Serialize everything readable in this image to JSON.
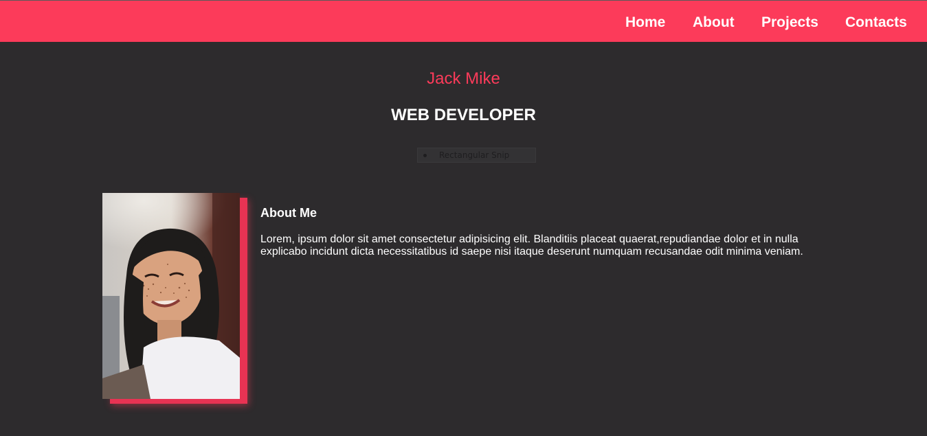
{
  "nav": {
    "items": [
      {
        "label": "Home"
      },
      {
        "label": "About"
      },
      {
        "label": "Projects"
      },
      {
        "label": "Contacts"
      }
    ]
  },
  "hero": {
    "name": "Jack Mike",
    "role": "WEB DEVELOPER"
  },
  "snip_tool": {
    "label": "Rectangular Snip"
  },
  "about": {
    "title": "About Me",
    "text": "Lorem, ipsum dolor sit amet consectetur adipisicing elit. Blanditiis placeat quaerat,repudiandae dolor et in nulla explicabo incidunt dicta necessitatibus id saepe nisi itaque deserunt numquam recusandae odit minima veniam."
  },
  "colors": {
    "accent": "#fc3b5a",
    "background": "#2d2b2d",
    "text": "#ffffff"
  },
  "icons": {
    "photo": "profile-photo"
  }
}
